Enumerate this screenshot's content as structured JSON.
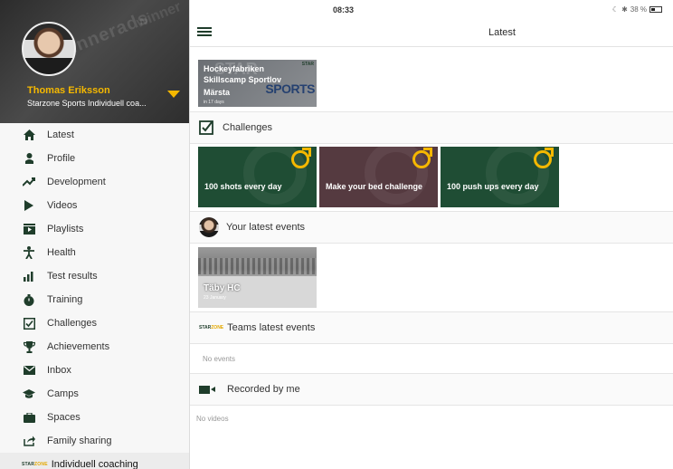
{
  "status_bar": {
    "time": "08:33",
    "battery": "38 %"
  },
  "header": {
    "title": "Latest"
  },
  "profile": {
    "name": "Thomas Eriksson",
    "team": "Starzone Sports Individuell coa..."
  },
  "sidebar": {
    "items": [
      {
        "label": "Latest",
        "icon": "home-icon"
      },
      {
        "label": "Profile",
        "icon": "person-icon"
      },
      {
        "label": "Development",
        "icon": "trend-icon"
      },
      {
        "label": "Videos",
        "icon": "play-icon"
      },
      {
        "label": "Playlists",
        "icon": "playlist-icon"
      },
      {
        "label": "Health",
        "icon": "health-icon"
      },
      {
        "label": "Test results",
        "icon": "bar-chart-icon"
      },
      {
        "label": "Training",
        "icon": "stopwatch-icon"
      },
      {
        "label": "Challenges",
        "icon": "checkbox-icon"
      },
      {
        "label": "Achievements",
        "icon": "trophy-icon"
      },
      {
        "label": "Inbox",
        "icon": "mail-icon"
      },
      {
        "label": "Camps",
        "icon": "graduation-cap-icon"
      },
      {
        "label": "Spaces",
        "icon": "briefcase-icon"
      },
      {
        "label": "Family sharing",
        "icon": "share-icon"
      },
      {
        "label": "Individuell coaching",
        "icon": "starzone-logo-icon"
      }
    ]
  },
  "camp": {
    "title_line1": "Hockeyfabriken",
    "title_line2": "Skillscamp Sportlov",
    "location": "Märsta",
    "when": "in 17 days",
    "brand_big": "SPORTS"
  },
  "sections": {
    "challenges": "Challenges",
    "your_events": "Your latest events",
    "teams_events": "Teams latest events",
    "recorded": "Recorded by me"
  },
  "challenges": [
    {
      "title": "100 shots every day"
    },
    {
      "title": "Make your bed challenge"
    },
    {
      "title": "100 push ups every day"
    }
  ],
  "event": {
    "title": "Täby HC",
    "date": "23 January"
  },
  "teams_empty": "No events",
  "recorded_empty": "No videos",
  "colors": {
    "accent": "#f5b800",
    "brand_green": "#1f3d2b",
    "card_green": "#1f4d34"
  }
}
